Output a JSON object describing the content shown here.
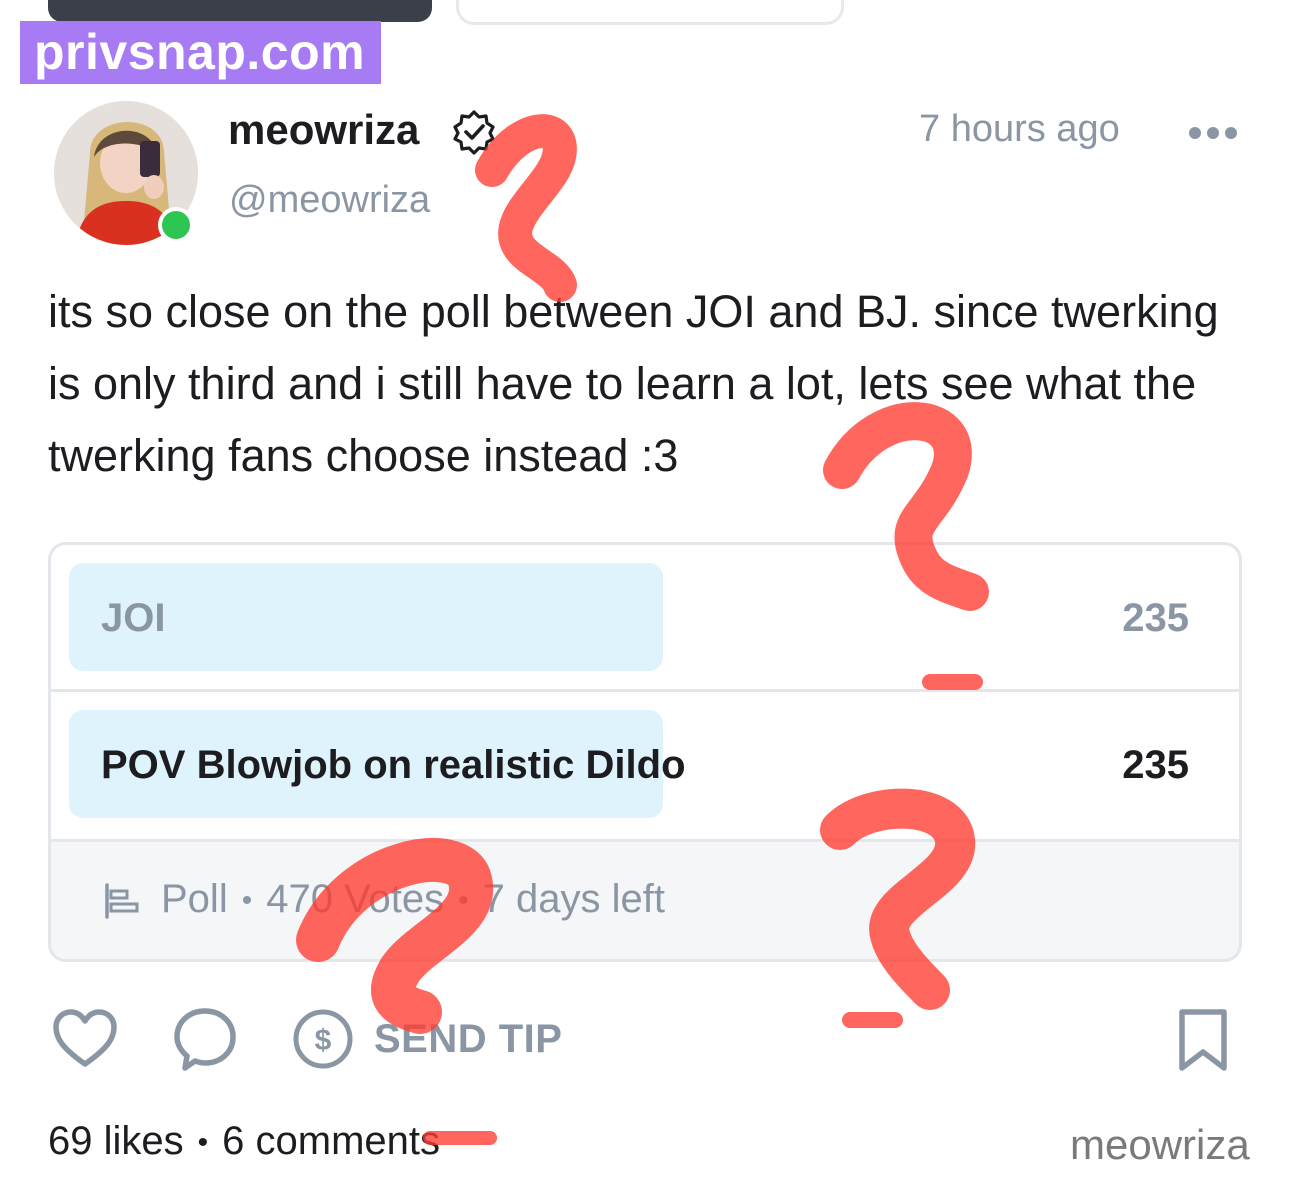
{
  "watermark": {
    "text": "privsnap.com"
  },
  "post": {
    "author": {
      "display_name": "meowriza",
      "handle": "@meowriza",
      "verified": true,
      "online": true
    },
    "timestamp": "7 hours ago",
    "text": "its so close on the poll between JOI and BJ. since twerking is only third and i still have to learn a lot, lets see what the twerking fans choose instead :3",
    "poll": {
      "options": [
        {
          "label": "JOI",
          "votes": "235",
          "share": 0.5
        },
        {
          "label": "POV Blowjob on realistic Dildo",
          "votes": "235",
          "share": 0.5
        }
      ],
      "type_label": "Poll",
      "votes_label": "470 Votes",
      "time_left": "7 days left"
    },
    "actions": {
      "tip_label": "SEND TIP"
    },
    "stats": {
      "likes": "69 likes",
      "comments": "6 comments"
    }
  },
  "corner_watermark": {
    "text": "meowriza"
  },
  "colors": {
    "accent_purple": "#a77bf3",
    "online_green": "#2dc653",
    "poll_bar": "#dff3fc",
    "muted_text": "#8a96a3",
    "scribble_red": "#ff3b30"
  }
}
